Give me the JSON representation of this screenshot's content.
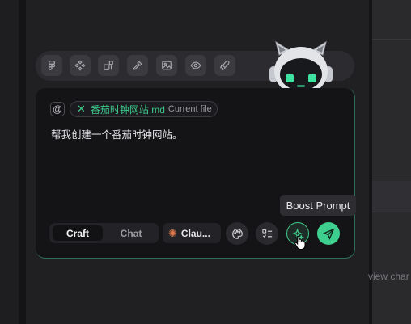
{
  "background": {
    "right_panel_text": "view char"
  },
  "toolbar": {
    "icons": [
      "figma-icon",
      "components-icon",
      "blocks-icon",
      "pipette-icon",
      "image-icon",
      "eye-icon",
      "rocket-icon"
    ]
  },
  "composer": {
    "at_symbol": "@",
    "attached_file": {
      "remove_symbol": "✕",
      "name": "番茄时钟网站.md",
      "tag": "Current file"
    },
    "prompt": "帮我创建一个番茄时钟网站。"
  },
  "controls": {
    "modes": {
      "craft": "Craft",
      "chat": "Chat",
      "selected": "Craft"
    },
    "model": {
      "label": "Clau...",
      "icon": "claude-spark-icon"
    },
    "buttons": [
      "palette-icon",
      "checklist-icon",
      "sparkle-icon",
      "send-icon"
    ]
  },
  "tooltip": {
    "text": "Boost Prompt"
  },
  "colors": {
    "accent": "#3ecf8e",
    "claude": "#e07a4a"
  }
}
